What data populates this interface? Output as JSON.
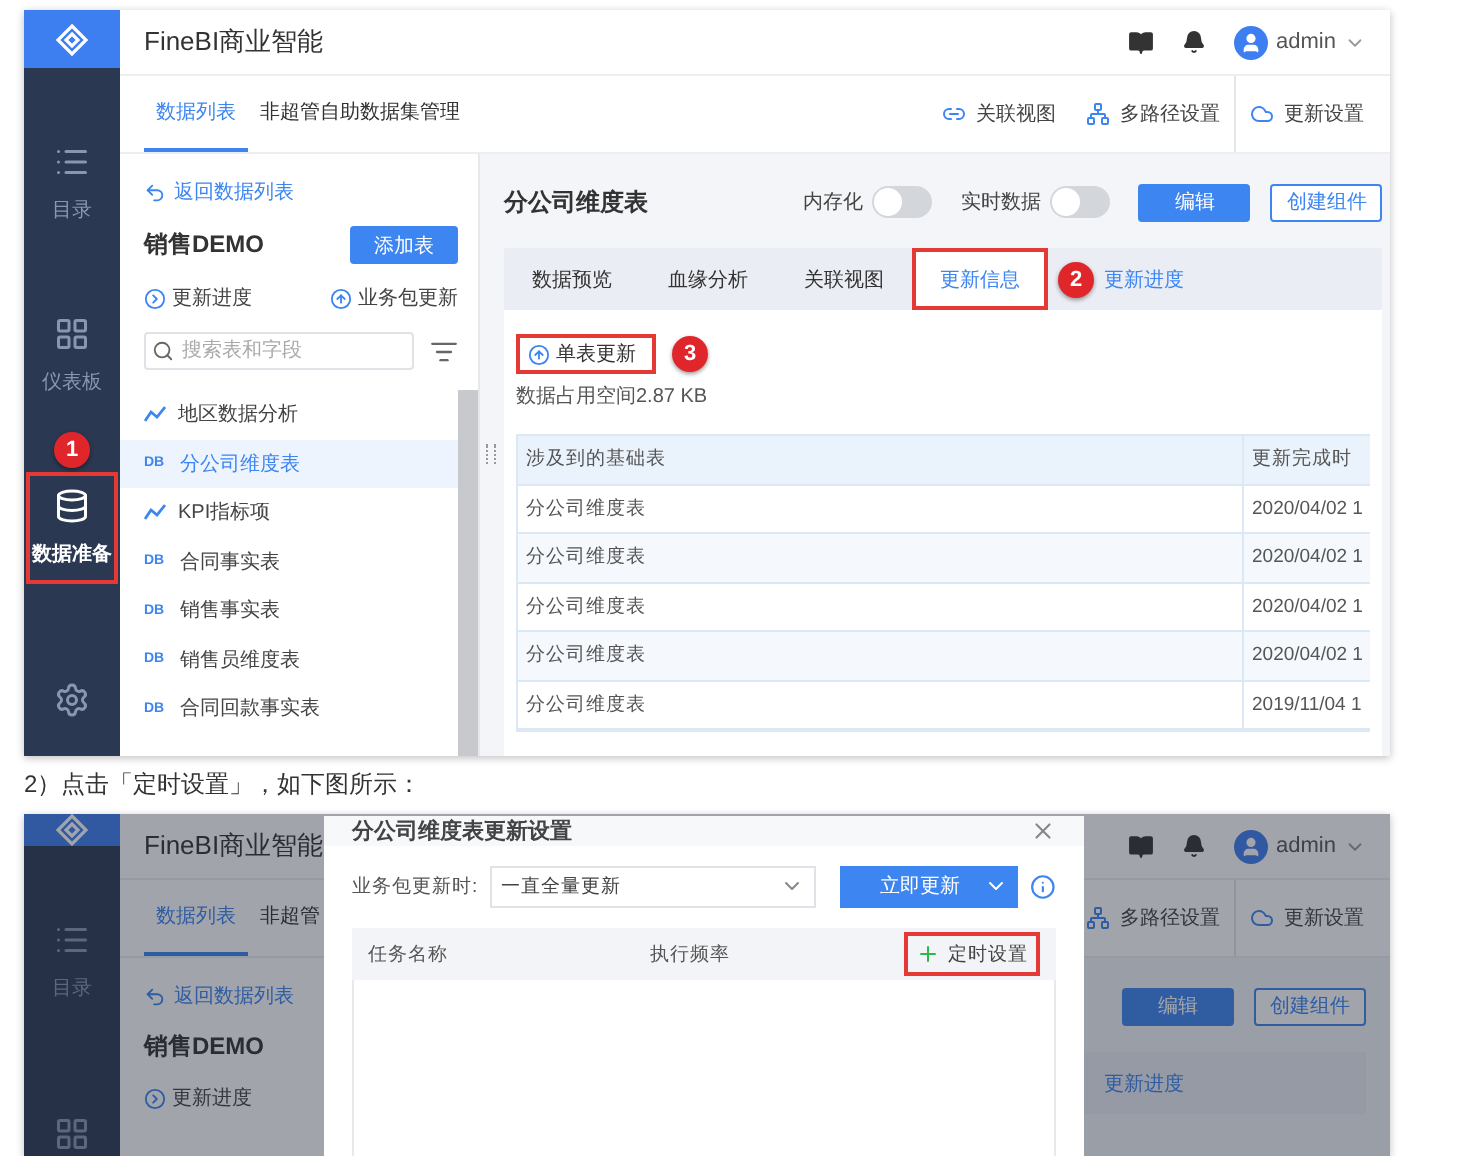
{
  "figure_1": {
    "app_title": "FineBI商业智能",
    "user": "admin",
    "sidebar": [
      {
        "label": "目录",
        "kind": "list",
        "selected": false,
        "highlighted": false
      },
      {
        "label": "仪表板",
        "kind": "dashboard",
        "selected": false,
        "highlighted": false
      },
      {
        "label": "数据准备",
        "kind": "database",
        "selected": true,
        "highlighted": true,
        "badge": "1"
      },
      {
        "kind": "gear",
        "selected": false,
        "highlighted": false
      }
    ],
    "tabs": [
      {
        "label": "数据列表",
        "selected": true
      },
      {
        "label": "非超管自助数据集管理",
        "selected": false
      }
    ],
    "actions": [
      {
        "label": "关联视图",
        "kind": "view"
      },
      {
        "label": "多路径设置",
        "kind": "path"
      },
      {
        "label": "更新设置",
        "kind": "cloud"
      }
    ],
    "panel": {
      "back": "返回数据列表",
      "package": "销售DEMO",
      "add_button": "添加表",
      "progress": "更新进度",
      "package_update": "业务包更新",
      "search_placeholder": "搜索表和字段",
      "items": [
        {
          "label": "地区数据分析",
          "kind": "analysis",
          "selected": false
        },
        {
          "label": "分公司维度表",
          "kind": "table",
          "tag": "DB",
          "selected": true
        },
        {
          "label": "KPI指标项",
          "kind": "analysis",
          "selected": false
        },
        {
          "label": "合同事实表",
          "kind": "table",
          "tag": "DB",
          "selected": false
        },
        {
          "label": "销售事实表",
          "kind": "table",
          "tag": "DB",
          "selected": false
        },
        {
          "label": "销售员维度表",
          "kind": "table",
          "tag": "DB",
          "selected": false
        },
        {
          "label": "合同回款事实表",
          "kind": "table",
          "tag": "DB",
          "selected": false
        }
      ]
    },
    "detail": {
      "title": "分公司维度表",
      "toggles": [
        {
          "label": "内存化",
          "on": false
        },
        {
          "label": "实时数据",
          "on": false
        }
      ],
      "buttons": [
        {
          "label": "编辑",
          "kind": "primary"
        },
        {
          "label": "创建组件",
          "kind": "outline"
        }
      ],
      "tabs": [
        {
          "label": "数据预览",
          "selected": false,
          "highlighted": false
        },
        {
          "label": "血缘分析",
          "selected": false,
          "highlighted": false
        },
        {
          "label": "关联视图",
          "selected": false,
          "highlighted": false
        },
        {
          "label": "更新信息",
          "selected": true,
          "highlighted": true,
          "badge": "2"
        }
      ],
      "progress_link": "更新进度",
      "update_button": {
        "label": "单表更新",
        "highlighted": true,
        "badge": "3"
      },
      "space": "数据占用空间2.87 KB",
      "table": {
        "columns": [
          "涉及到的基础表",
          "更新完成时"
        ],
        "rows": [
          [
            "分公司维度表",
            "2020/04/02 1"
          ],
          [
            "分公司维度表",
            "2020/04/02 1"
          ],
          [
            "分公司维度表",
            "2020/04/02 1"
          ],
          [
            "分公司维度表",
            "2020/04/02 1"
          ],
          [
            "分公司维度表",
            "2019/11/04 1"
          ]
        ]
      }
    }
  },
  "caption": "2）点击「定时设置」，如下图所示：",
  "figure_2": {
    "app_title": "FineBI商业智能",
    "user": "admin",
    "sidebar": [
      {
        "label": "目录",
        "kind": "list",
        "selected": false,
        "highlighted": false
      },
      {
        "kind": "dashboard",
        "selected": false,
        "highlighted": false
      }
    ],
    "tabs": [
      {
        "label": "数据列表",
        "selected": true
      },
      {
        "label": "非超管",
        "selected": false
      }
    ],
    "actions": [
      {
        "label": "多路径设置",
        "kind": "path"
      },
      {
        "label": "更新设置",
        "kind": "cloud"
      }
    ],
    "panel": {
      "back": "返回数据列表",
      "package": "销售DEMO",
      "progress": "更新进度"
    },
    "detail": {
      "buttons": [
        {
          "label": "编辑",
          "kind": "primary"
        },
        {
          "label": "创建组件",
          "kind": "outline"
        }
      ],
      "progress_link": "更新进度"
    },
    "dialog": {
      "title": "分公司维度表更新设置",
      "field_label": "业务包更新时:",
      "select_value": "一直全量更新",
      "update_button": "立即更新",
      "columns": [
        "任务名称",
        "执行频率"
      ],
      "add_button": {
        "label": "定时设置",
        "highlighted": true
      }
    }
  }
}
